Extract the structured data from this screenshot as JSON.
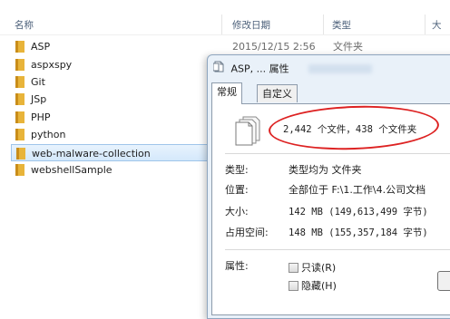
{
  "columns": {
    "name": "名称",
    "date": "修改日期",
    "type": "类型",
    "size": "大"
  },
  "folders": [
    {
      "name": "ASP",
      "date": "2015/12/15 2:56",
      "type": "文件夹"
    },
    {
      "name": "aspxspy"
    },
    {
      "name": "Git"
    },
    {
      "name": "JSp"
    },
    {
      "name": "PHP"
    },
    {
      "name": "python"
    },
    {
      "name": "web-malware-collection",
      "selected": true
    },
    {
      "name": "webshellSample"
    }
  ],
  "dialog": {
    "title": "ASP, ... 属性",
    "tabs": [
      "常规",
      "自定义"
    ],
    "active_tab": "常规",
    "summary": "2,442 个文件，438 个文件夹",
    "fields": {
      "type_label": "类型:",
      "type_value": "类型均为 文件夹",
      "location_label": "位置:",
      "location_value": "全部位于 F:\\1.工作\\4.公司文档",
      "size_label": "大小:",
      "size_value": "142 MB (149,613,499 字节)",
      "disk_label": "占用空间:",
      "disk_value": "148 MB (155,357,184 字节)",
      "attr_label": "属性:"
    },
    "attributes": {
      "readonly": "只读(R)",
      "hidden": "隐藏(H)"
    }
  },
  "colors": {
    "folder": "#e8b43a",
    "selection": "#d4e8fb",
    "annotation": "#dd2222"
  }
}
